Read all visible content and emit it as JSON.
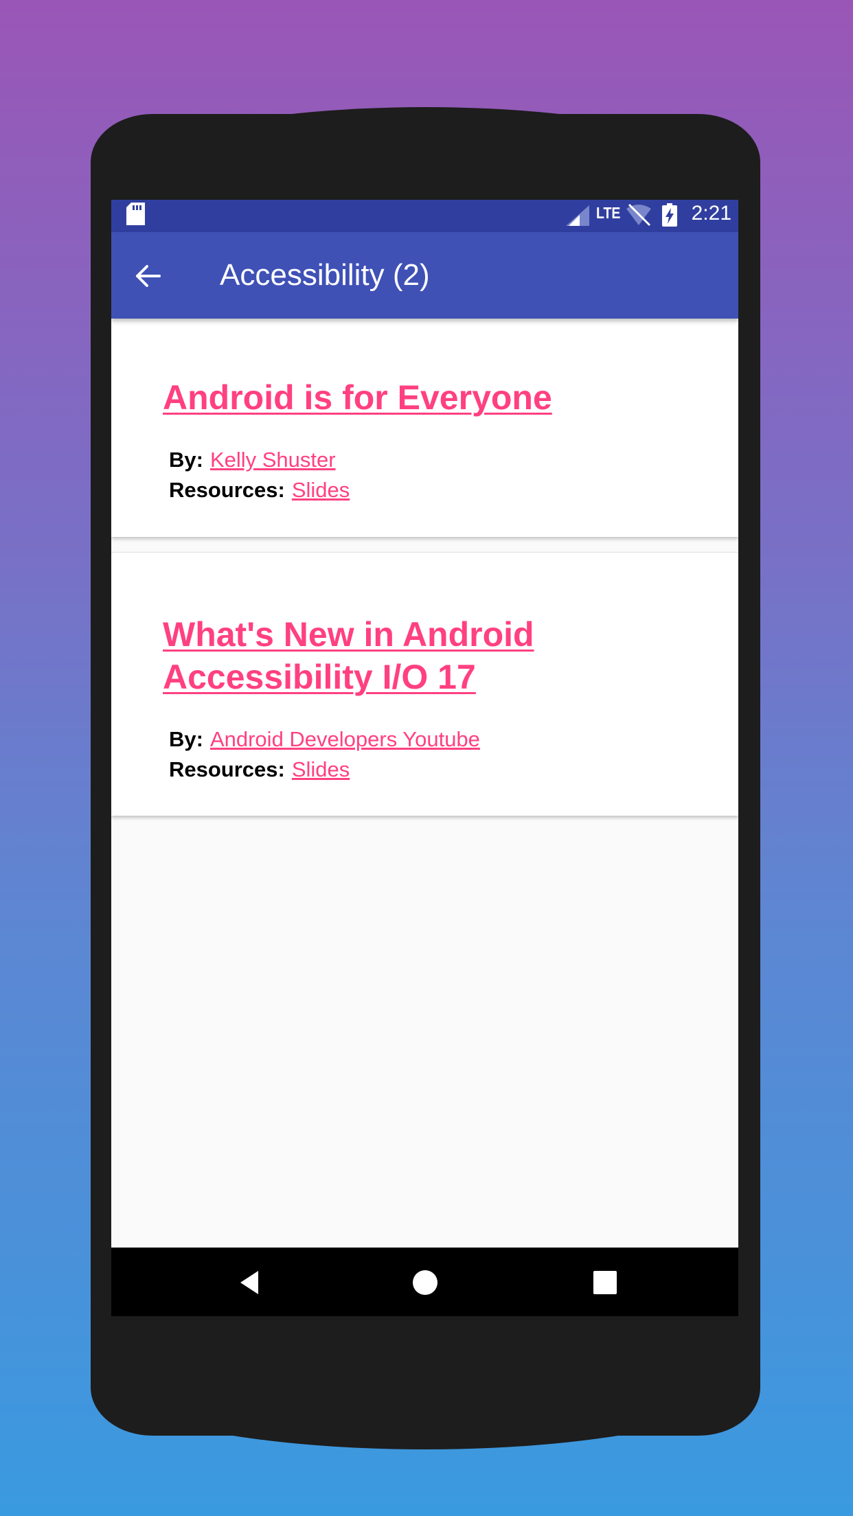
{
  "status_bar": {
    "network_label": "LTE",
    "time": "2:21",
    "icons": [
      "sd-card-icon",
      "signal-icon",
      "wifi-off-icon",
      "battery-charging-icon"
    ]
  },
  "app_bar": {
    "back_icon": "arrow-back-icon",
    "title": "Accessibility (2)"
  },
  "talks": [
    {
      "title": "Android is for Everyone",
      "by_label": "By:",
      "speaker": "Kelly Shuster",
      "resources_label": "Resources:",
      "resource": "Slides"
    },
    {
      "title": "What's New in Android Accessibility I/O 17",
      "by_label": "By:",
      "speaker": "Android Developers Youtube",
      "resources_label": "Resources:",
      "resource": "Slides"
    }
  ],
  "nav_bar": {
    "icons": [
      "nav-back-icon",
      "nav-home-icon",
      "nav-recents-icon"
    ]
  },
  "colors": {
    "status_bar": "#303f9f",
    "app_bar": "#3f51b5",
    "accent": "#ff4081",
    "background_top": "#9a56b6",
    "background_bottom": "#3a9ae0"
  }
}
